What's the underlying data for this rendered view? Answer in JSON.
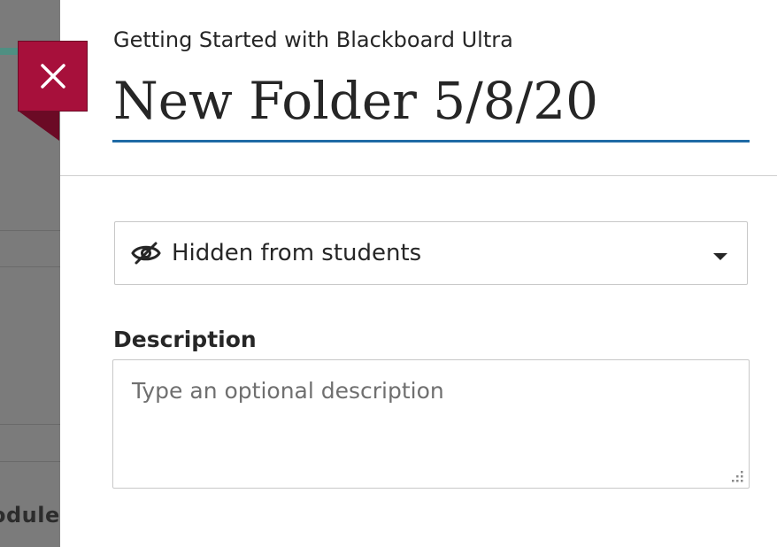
{
  "background": {
    "partial_text": "odule"
  },
  "panel": {
    "close_icon": "close-icon",
    "course_title": "Getting Started with Blackboard Ultra",
    "folder_title": "New Folder 5/8/20",
    "visibility": {
      "icon": "eye-slash-icon",
      "label": "Hidden from students"
    },
    "description": {
      "label": "Description",
      "placeholder": "Type an optional description"
    }
  },
  "colors": {
    "close_button": "#a7103b",
    "title_underline": "#1f6aa5",
    "overlay": "#7b7b7b"
  }
}
